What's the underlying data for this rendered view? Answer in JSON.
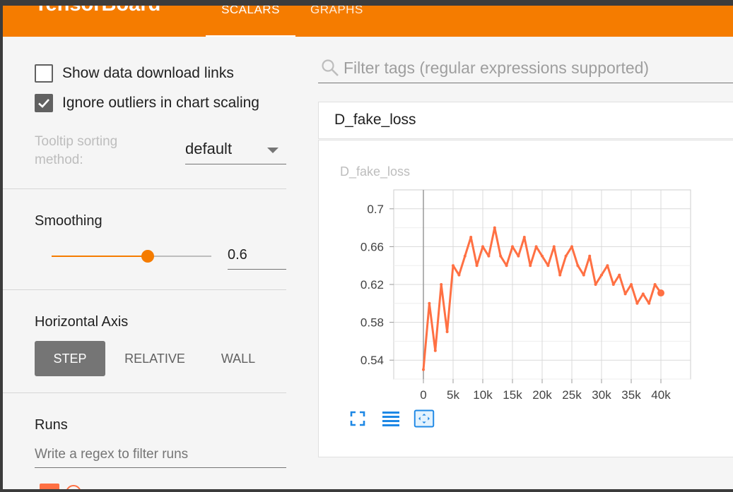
{
  "header": {
    "app_title": "TensorBoard",
    "tabs": [
      {
        "label": "SCALARS",
        "active": true
      },
      {
        "label": "GRAPHS",
        "active": false
      }
    ],
    "accent_color": "#f57c00"
  },
  "sidebar": {
    "show_download_links": {
      "label": "Show data download links",
      "checked": false
    },
    "ignore_outliers": {
      "label": "Ignore outliers in chart scaling",
      "checked": true
    },
    "tooltip_sorting": {
      "label": "Tooltip sorting method:",
      "value": "default"
    },
    "smoothing": {
      "title": "Smoothing",
      "value": "0.6",
      "slider_fraction": 0.6
    },
    "horizontal_axis": {
      "title": "Horizontal Axis",
      "options": [
        "STEP",
        "RELATIVE",
        "WALL"
      ],
      "selected": "STEP"
    },
    "runs": {
      "title": "Runs",
      "filter_placeholder": "Write a regex to filter runs"
    }
  },
  "main": {
    "tag_filter_placeholder": "Filter tags (regular expressions supported)",
    "card": {
      "title": "D_fake_loss",
      "chart_title": "D_fake_loss",
      "icons": [
        "fullscreen-icon",
        "log-scale-icon",
        "fit-domain-icon"
      ]
    }
  },
  "chart_data": {
    "type": "line",
    "title": "D_fake_loss",
    "x_ticks": [
      "0",
      "5k",
      "10k",
      "15k",
      "20k",
      "25k",
      "30k",
      "35k",
      "40k"
    ],
    "y_ticks": [
      "0.54",
      "0.58",
      "0.62",
      "0.66",
      "0.7"
    ],
    "xlim": [
      -5000,
      45000
    ],
    "ylim": [
      0.52,
      0.72
    ],
    "grid": true,
    "series": [
      {
        "color": "#ff7043",
        "smoothed": true,
        "x": [
          0,
          1000,
          2000,
          3000,
          4000,
          5000,
          6000,
          7000,
          8000,
          9000,
          10000,
          11000,
          12000,
          13000,
          14000,
          15000,
          16000,
          17000,
          18000,
          19000,
          20000,
          21000,
          22000,
          23000,
          24000,
          25000,
          26000,
          27000,
          28000,
          29000,
          30000,
          31000,
          32000,
          33000,
          34000,
          35000,
          36000,
          37000,
          38000,
          39000,
          40000
        ],
        "y": [
          0.53,
          0.6,
          0.55,
          0.62,
          0.57,
          0.64,
          0.63,
          0.65,
          0.67,
          0.64,
          0.66,
          0.65,
          0.68,
          0.65,
          0.64,
          0.66,
          0.65,
          0.67,
          0.64,
          0.66,
          0.65,
          0.64,
          0.66,
          0.63,
          0.65,
          0.66,
          0.64,
          0.63,
          0.65,
          0.62,
          0.63,
          0.64,
          0.62,
          0.63,
          0.61,
          0.62,
          0.6,
          0.61,
          0.6,
          0.62,
          0.611
        ]
      }
    ]
  }
}
